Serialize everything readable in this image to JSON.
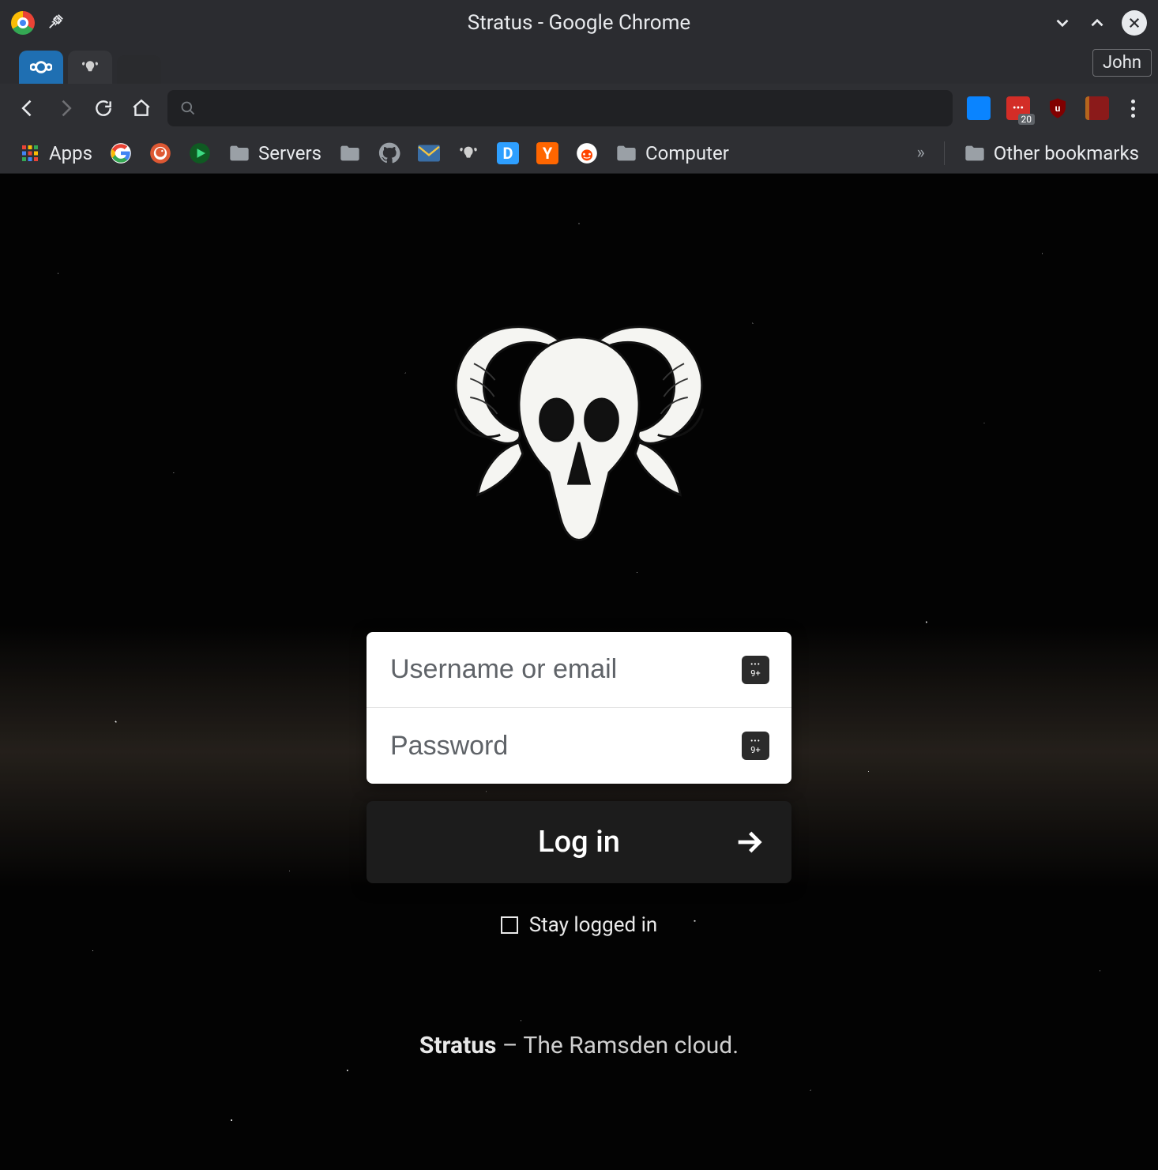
{
  "window": {
    "title": "Stratus - Google Chrome",
    "profile_name": "John"
  },
  "tabs": [
    {
      "id": "tab-nextcloud",
      "icon": "nextcloud-icon",
      "active": true
    },
    {
      "id": "tab-ram",
      "icon": "ram-skull-icon",
      "active": false
    }
  ],
  "toolbar": {
    "url": "",
    "extensions": [
      {
        "name": "news",
        "color": "#0a84ff",
        "badge": ""
      },
      {
        "name": "lastpass",
        "color": "#d32d27",
        "badge": "20"
      },
      {
        "name": "ublock",
        "color": "#800000",
        "badge": ""
      },
      {
        "name": "book",
        "color": "#b5651d",
        "badge": ""
      }
    ]
  },
  "bookmarks": {
    "apps_label": "Apps",
    "items": [
      {
        "name": "google",
        "type": "icon"
      },
      {
        "name": "duckduckgo",
        "type": "icon"
      },
      {
        "name": "play",
        "type": "icon"
      },
      {
        "name": "servers",
        "type": "folder",
        "label": "Servers"
      },
      {
        "name": "folder-blank",
        "type": "folder",
        "label": ""
      },
      {
        "name": "github",
        "type": "icon"
      },
      {
        "name": "mail",
        "type": "icon"
      },
      {
        "name": "ram",
        "type": "icon"
      },
      {
        "name": "disqus",
        "type": "icon"
      },
      {
        "name": "hn",
        "type": "icon"
      },
      {
        "name": "reddit",
        "type": "icon"
      },
      {
        "name": "computer",
        "type": "folder",
        "label": "Computer"
      }
    ],
    "other_label": "Other bookmarks"
  },
  "login": {
    "username_placeholder": "Username or email",
    "password_placeholder": "Password",
    "button_label": "Log in",
    "stay_label": "Stay logged in",
    "pw_badge": "9+"
  },
  "footer": {
    "app_name": "Stratus",
    "tagline_rest": " – The Ramsden cloud."
  }
}
